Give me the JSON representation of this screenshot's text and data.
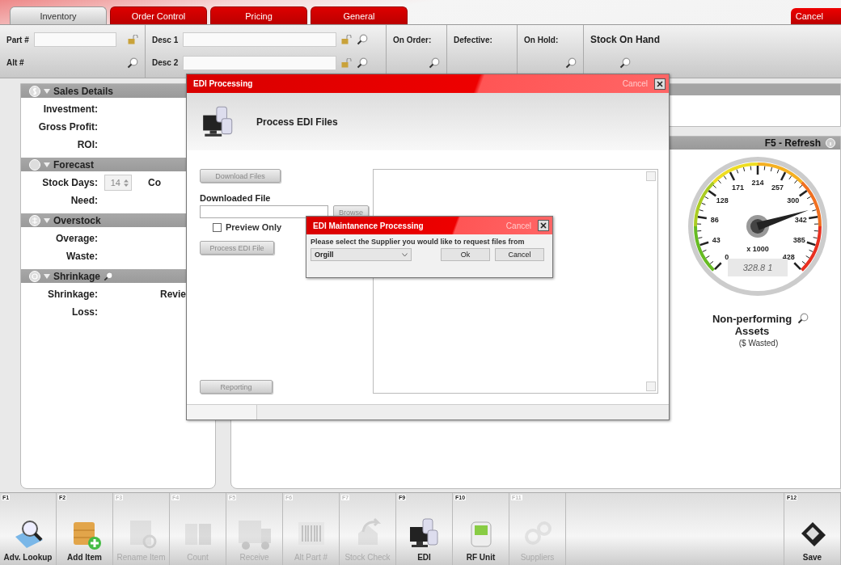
{
  "tabs": [
    {
      "label": "Inventory",
      "selected": true
    },
    {
      "label": "Order Control",
      "selected": false
    },
    {
      "label": "Pricing",
      "selected": false
    },
    {
      "label": "General",
      "selected": false
    }
  ],
  "cancel_button": "Cancel",
  "header": {
    "part_label": "Part #",
    "alt_label": "Alt #",
    "desc1_label": "Desc 1",
    "desc2_label": "Desc 2",
    "stats": [
      {
        "label": "On Order:",
        "has_search": true
      },
      {
        "label": "Defective:",
        "has_search": false
      },
      {
        "label": "On Hold:",
        "has_search": true
      }
    ],
    "stock_label": "Stock On Hand"
  },
  "sections": [
    {
      "title": "Sales Details",
      "has_search": false,
      "rows": [
        {
          "label": "Investment:"
        },
        {
          "label": "Gross Profit:"
        },
        {
          "label": "ROI:"
        }
      ]
    },
    {
      "title": "Forecast",
      "has_search": false,
      "rows": [
        {
          "label": "Stock Days:",
          "spinner": "14",
          "side": "Co"
        },
        {
          "label": "Need:"
        }
      ]
    },
    {
      "title": "Overstock",
      "has_search": false,
      "rows": [
        {
          "label": "Overage:"
        },
        {
          "label": "Waste:"
        }
      ]
    },
    {
      "title": "Shrinkage",
      "has_search": true,
      "rows": [
        {
          "label": "Shrinkage:",
          "side": "Revie"
        },
        {
          "label": "Loss:"
        }
      ]
    }
  ],
  "refresh_label": "F5 - Refresh",
  "gauge": {
    "ticks": [
      "0",
      "43",
      "86",
      "128",
      "171",
      "214",
      "257",
      "300",
      "342",
      "385",
      "428"
    ],
    "multiplier": "x 1000",
    "reading": "328.8 1",
    "level": 0.768,
    "title": "Non-performing Assets",
    "subtitle": "($ Wasted)"
  },
  "edi_dialog": {
    "title": "EDI Processing",
    "cancel": "Cancel",
    "heading": "Process EDI Files",
    "download_button": "Download Files",
    "file_label": "Downloaded File",
    "browse_button": "Browse",
    "preview": {
      "label": "Preview Only",
      "checked": false
    },
    "process_button": "Process EDI File",
    "reporting_button": "Reporting"
  },
  "maintenance_dialog": {
    "title": "EDI Maintanence Processing",
    "cancel": "Cancel",
    "prompt": "Please select the Supplier you would like to request files from",
    "supplier": "Orgill",
    "ok_button": "Ok",
    "cancel_button": "Cancel"
  },
  "toolbar": [
    {
      "key": "F1",
      "label": "Adv. Lookup",
      "disabled": false
    },
    {
      "key": "F2",
      "label": "Add Item",
      "disabled": false
    },
    {
      "key": "F3",
      "label": "Rename Item",
      "disabled": true
    },
    {
      "key": "F4",
      "label": "Count",
      "disabled": true
    },
    {
      "key": "F5",
      "label": "Receive",
      "disabled": true
    },
    {
      "key": "F6",
      "label": "Alt Part #",
      "disabled": true
    },
    {
      "key": "F7",
      "label": "Stock Check",
      "disabled": true
    },
    {
      "key": "F9",
      "label": "EDI",
      "disabled": false
    },
    {
      "key": "F10",
      "label": "RF Unit",
      "disabled": false
    },
    {
      "key": "F11",
      "label": "Suppliers",
      "disabled": true
    }
  ],
  "save_tool": {
    "key": "F12",
    "label": "Save",
    "disabled": false
  }
}
